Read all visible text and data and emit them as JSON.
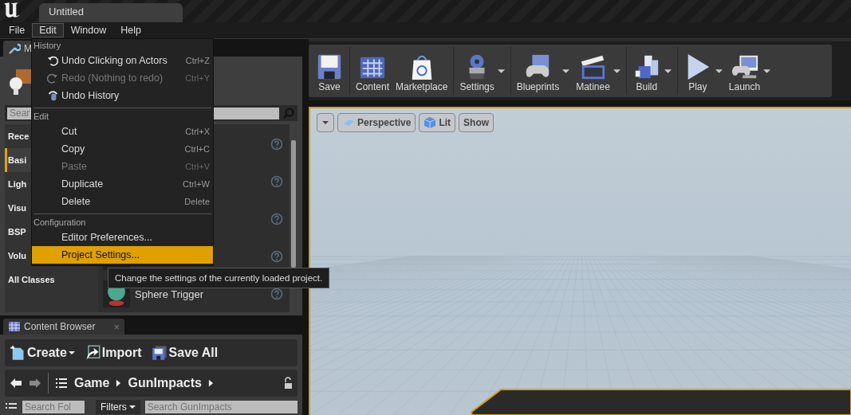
{
  "window": {
    "title": "Untitled"
  },
  "menubar": [
    {
      "label": "File",
      "selected": false
    },
    {
      "label": "Edit",
      "selected": true
    },
    {
      "label": "Window",
      "selected": false
    },
    {
      "label": "Help",
      "selected": false
    }
  ],
  "edit_menu": {
    "sections": [
      {
        "heading": "History",
        "items": [
          {
            "label": "Undo Clicking on Actors",
            "shortcut": "Ctrl+Z",
            "disabled": false,
            "selected": false
          },
          {
            "label": "Redo (Nothing to redo)",
            "shortcut": "Ctrl+Y",
            "disabled": true,
            "selected": false
          },
          {
            "label": "Undo History",
            "disabled": false,
            "selected": false
          }
        ]
      },
      {
        "heading": "Edit",
        "items": [
          {
            "label": "Cut",
            "shortcut": "Ctrl+X",
            "disabled": false,
            "selected": false
          },
          {
            "label": "Copy",
            "shortcut": "Ctrl+C",
            "disabled": false,
            "selected": false
          },
          {
            "label": "Paste",
            "shortcut": "Ctrl+V",
            "disabled": true,
            "selected": false
          },
          {
            "label": "Duplicate",
            "shortcut": "Ctrl+W",
            "disabled": false,
            "selected": false
          },
          {
            "label": "Delete",
            "shortcut": "Delete",
            "disabled": false,
            "selected": false
          }
        ]
      },
      {
        "heading": "Configuration",
        "items": [
          {
            "label": "Editor Preferences...",
            "disabled": false,
            "selected": false
          },
          {
            "label": "Project Settings...",
            "disabled": false,
            "selected": true
          }
        ]
      }
    ]
  },
  "tooltip": "Change the settings of the currently loaded project.",
  "modes_panel": {
    "tab": "M",
    "search": {
      "placeholder": "Sear"
    },
    "categories": [
      {
        "label": "Rece",
        "selected": false
      },
      {
        "label": "Basi",
        "selected": true
      },
      {
        "label": "Ligh",
        "selected": false
      },
      {
        "label": "Visu",
        "selected": false
      },
      {
        "label": "BSP",
        "selected": false
      },
      {
        "label": "Volu",
        "selected": false
      },
      {
        "label": "All Classes",
        "selected": false
      }
    ],
    "visible_item": "Sphere Trigger"
  },
  "content_browser": {
    "tab": "Content Browser",
    "close": "×",
    "toolbar": [
      "Create",
      "Import",
      "Save All"
    ],
    "path": [
      "Game",
      "GunImpacts"
    ],
    "folder_search": {
      "placeholder": "Search Fol"
    },
    "filters": "Filters",
    "asset_search": {
      "placeholder": "Search GunImpacts"
    }
  },
  "main_toolbar": [
    [
      {
        "label": "Save",
        "has_menu": false
      }
    ],
    [
      {
        "label": "Content",
        "has_menu": false
      },
      {
        "label": "Marketplace",
        "has_menu": false
      }
    ],
    [
      {
        "label": "Settings",
        "has_menu": true
      }
    ],
    [
      {
        "label": "Blueprints",
        "has_menu": true
      },
      {
        "label": "Matinee",
        "has_menu": true
      }
    ],
    [
      {
        "label": "Build",
        "has_menu": true
      }
    ],
    [
      {
        "label": "Play",
        "has_menu": true
      },
      {
        "label": "Launch",
        "has_menu": true
      }
    ]
  ],
  "viewport": {
    "buttons": [
      "Perspective",
      "Lit",
      "Show"
    ]
  }
}
